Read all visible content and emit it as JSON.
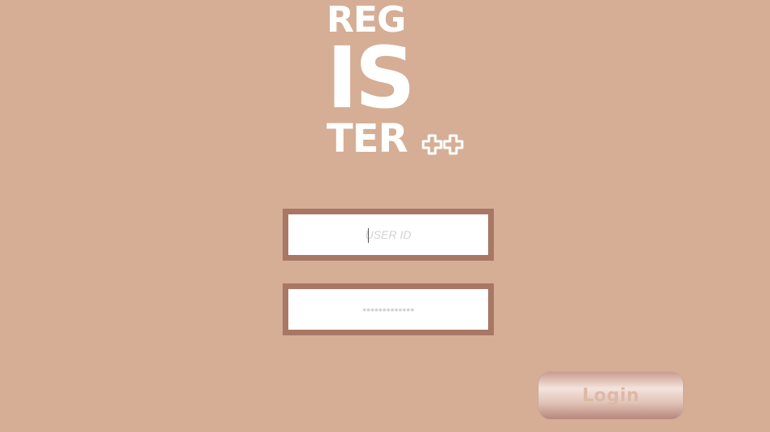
{
  "app": {
    "background_color": "#D5AE95",
    "logo": {
      "line1": "REG",
      "line2": "IS",
      "line3": "TER",
      "suffix_icon": "plus-plus-icon",
      "color": "#FFFFFF"
    }
  },
  "form": {
    "user_id": {
      "placeholder": "USER ID",
      "value": ""
    },
    "password": {
      "placeholder": "•••••••••••••",
      "value": ""
    },
    "field_border_color": "#A97766"
  },
  "actions": {
    "login_label": "Login"
  }
}
